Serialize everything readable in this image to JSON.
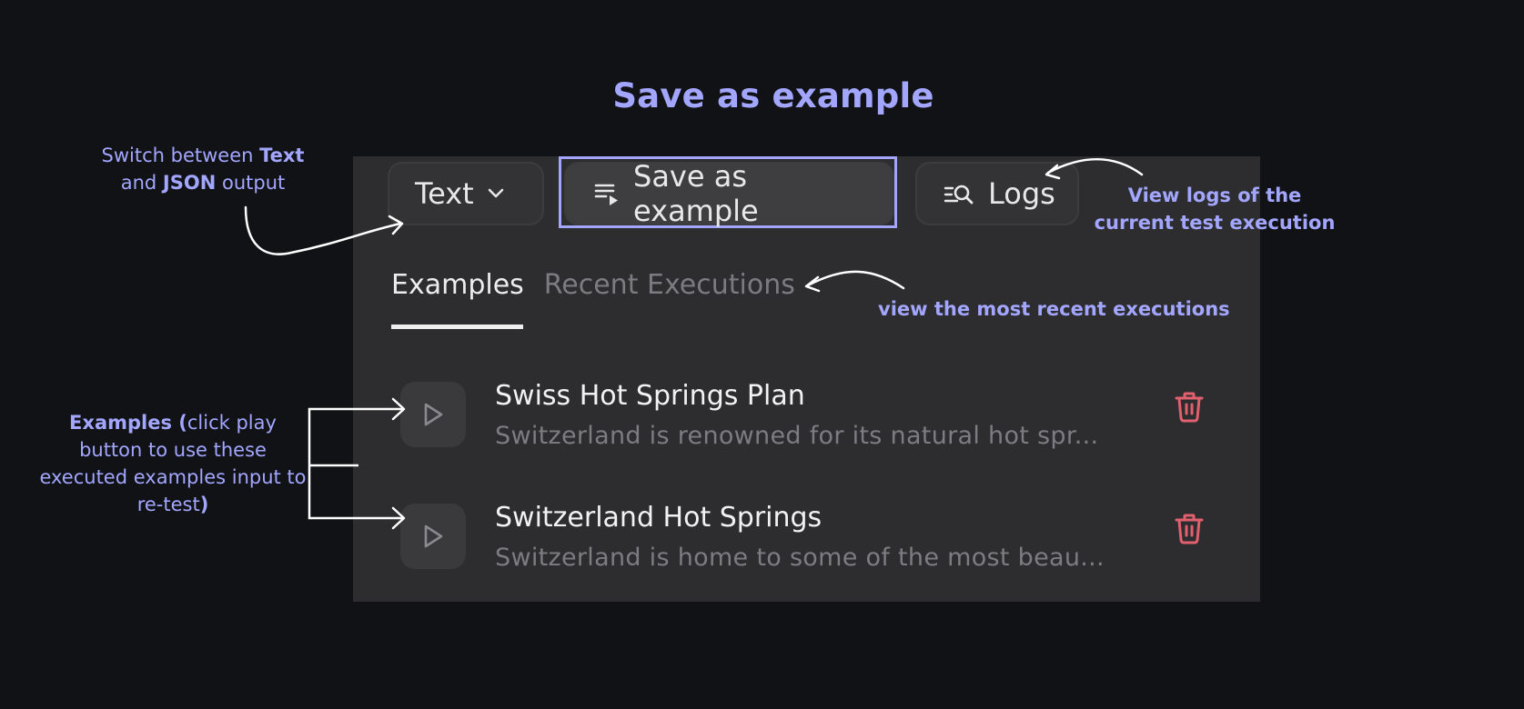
{
  "title": "Save as example",
  "toolbar": {
    "format_select": {
      "value": "Text",
      "icon": "chevron-down-icon"
    },
    "save_button": {
      "label": "Save as example",
      "icon": "playlist-play-icon"
    },
    "logs_button": {
      "label": "Logs",
      "icon": "list-search-icon"
    }
  },
  "tabs": [
    {
      "label": "Examples",
      "active": true
    },
    {
      "label": "Recent Executions",
      "active": false
    }
  ],
  "examples": [
    {
      "title": "Swiss Hot Springs Plan",
      "description": "Switzerland is renowned for its natural hot spr...",
      "play_icon": "play-icon",
      "delete_icon": "trash-icon"
    },
    {
      "title": "Switzerland Hot Springs",
      "description": "Switzerland is home to some of the most beau...",
      "play_icon": "play-icon",
      "delete_icon": "trash-icon"
    }
  ],
  "annotations": {
    "switch": {
      "pre": "Switch between ",
      "b1": "Text",
      "mid": "and ",
      "b2": "JSON",
      "post": " output"
    },
    "logs": "View logs of the current test execution",
    "recent": "view the most recent executions",
    "examples": {
      "bold": "Examples (",
      "text": "click play button to use these executed examples input to re-test",
      "close": ")"
    }
  },
  "colors": {
    "accent": "#a3a6ff",
    "background": "#111216",
    "panel": "#2d2d2f",
    "delete": "#e2606e"
  }
}
